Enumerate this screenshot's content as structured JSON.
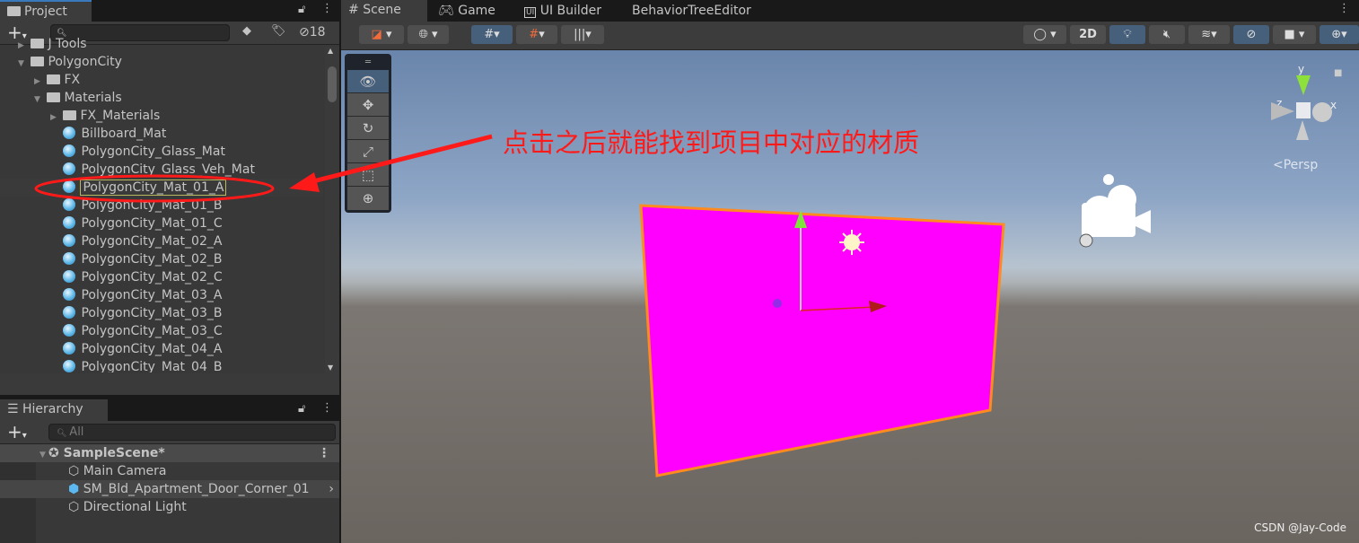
{
  "project": {
    "tab": "Project",
    "hidden_count": "18",
    "search_placeholder": "",
    "items": [
      {
        "label": "J Tools",
        "type": "folder",
        "depth": 1,
        "expanded": false
      },
      {
        "label": "PolygonCity",
        "type": "folder",
        "depth": 1,
        "expanded": true
      },
      {
        "label": "FX",
        "type": "folder",
        "depth": 2,
        "expanded": false
      },
      {
        "label": "Materials",
        "type": "folder",
        "depth": 2,
        "expanded": true
      },
      {
        "label": "FX_Materials",
        "type": "folder",
        "depth": 3,
        "expanded": false
      },
      {
        "label": "Billboard_Mat",
        "type": "material",
        "depth": 3
      },
      {
        "label": "PolygonCity_Glass_Mat",
        "type": "material",
        "depth": 3
      },
      {
        "label": "PolygonCity_Glass_Veh_Mat",
        "type": "material",
        "depth": 3
      },
      {
        "label": "PolygonCity_Mat_01_A",
        "type": "material",
        "depth": 3,
        "highlighted": true
      },
      {
        "label": "PolygonCity_Mat_01_B",
        "type": "material",
        "depth": 3
      },
      {
        "label": "PolygonCity_Mat_01_C",
        "type": "material",
        "depth": 3
      },
      {
        "label": "PolygonCity_Mat_02_A",
        "type": "material",
        "depth": 3
      },
      {
        "label": "PolygonCity_Mat_02_B",
        "type": "material",
        "depth": 3
      },
      {
        "label": "PolygonCity_Mat_02_C",
        "type": "material",
        "depth": 3
      },
      {
        "label": "PolygonCity_Mat_03_A",
        "type": "material",
        "depth": 3
      },
      {
        "label": "PolygonCity_Mat_03_B",
        "type": "material",
        "depth": 3
      },
      {
        "label": "PolygonCity_Mat_03_C",
        "type": "material",
        "depth": 3
      },
      {
        "label": "PolygonCity_Mat_04_A",
        "type": "material",
        "depth": 3
      },
      {
        "label": "PolygonCity_Mat_04_B",
        "type": "material",
        "depth": 3
      }
    ]
  },
  "hierarchy": {
    "tab": "Hierarchy",
    "search_placeholder": "All",
    "scene": "SampleScene*",
    "items": [
      {
        "label": "Main Camera",
        "selected": false
      },
      {
        "label": "SM_Bld_Apartment_Door_Corner_01",
        "selected": true,
        "prefab": true
      },
      {
        "label": "Directional Light",
        "selected": false
      }
    ]
  },
  "scene_tabs": [
    {
      "label": "Scene",
      "icon": "hash-icon",
      "active": true
    },
    {
      "label": "Game",
      "icon": "gamepad-icon"
    },
    {
      "label": "UI Builder",
      "icon": "ui-icon"
    },
    {
      "label": "BehaviorTreeEditor"
    }
  ],
  "scene_toolbar": {
    "mode_2d": "2D"
  },
  "gizmo": {
    "x": "x",
    "y": "y",
    "z": "z",
    "projection": "Persp"
  },
  "annotation": {
    "text": "点击之后就能找到项目中对应的材质",
    "color": "#ff1a1a"
  },
  "object_color": "#ff00ff",
  "watermark": "CSDN @Jay-Code"
}
